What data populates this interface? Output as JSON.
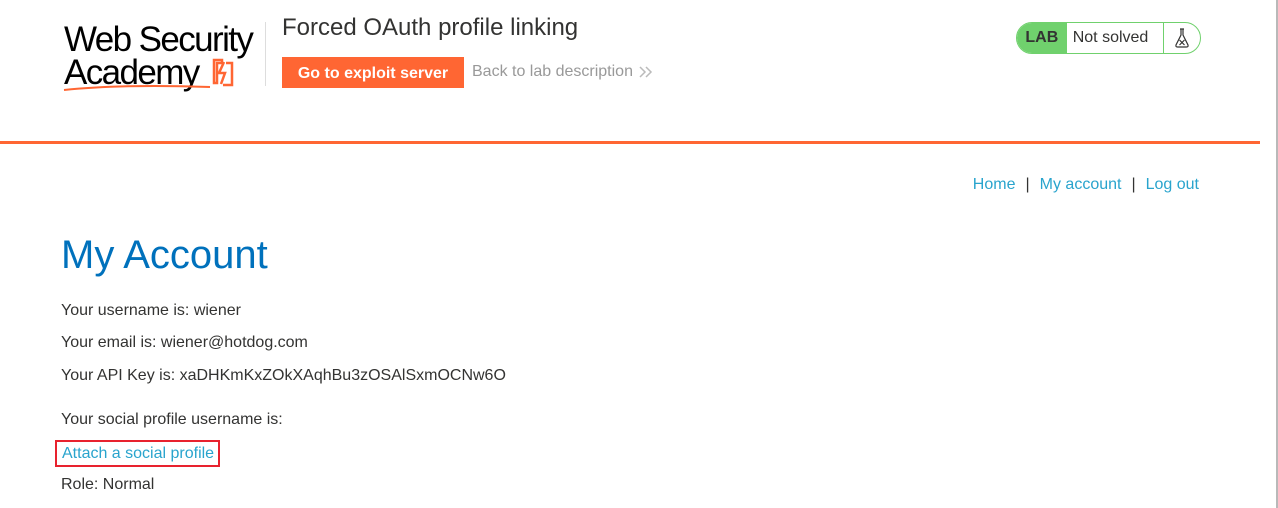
{
  "header": {
    "logo": {
      "line1": "Web Security",
      "line2": "Academy",
      "icon": "lightning-bolt-icon"
    },
    "lab_title": "Forced OAuth profile linking",
    "exploit_button_label": "Go to exploit server",
    "back_link_label": "Back to lab description",
    "back_link_icon": "double-chevron-right-icon",
    "status": {
      "badge": "LAB",
      "text": "Not solved",
      "icon": "flask-icon",
      "color": "#70d16d"
    },
    "accent_color": "#ff6633"
  },
  "nav": {
    "home": "Home",
    "separator": "|",
    "my_account": "My account",
    "log_out": "Log out"
  },
  "account": {
    "title": "My Account",
    "username_line": "Your username is: wiener",
    "email_line": "Your email is: wiener@hotdog.com",
    "api_key_line": "Your API Key is: xaDHKmKxZOkXAqhBu3zOSAlSxmOCNw6O",
    "social_username_line": "Your social profile username is:",
    "attach_link": "Attach a social profile",
    "role_line": "Role: Normal"
  },
  "colors": {
    "link": "#29a4cd",
    "title": "#0071bc",
    "highlight_border": "#e8222e"
  }
}
